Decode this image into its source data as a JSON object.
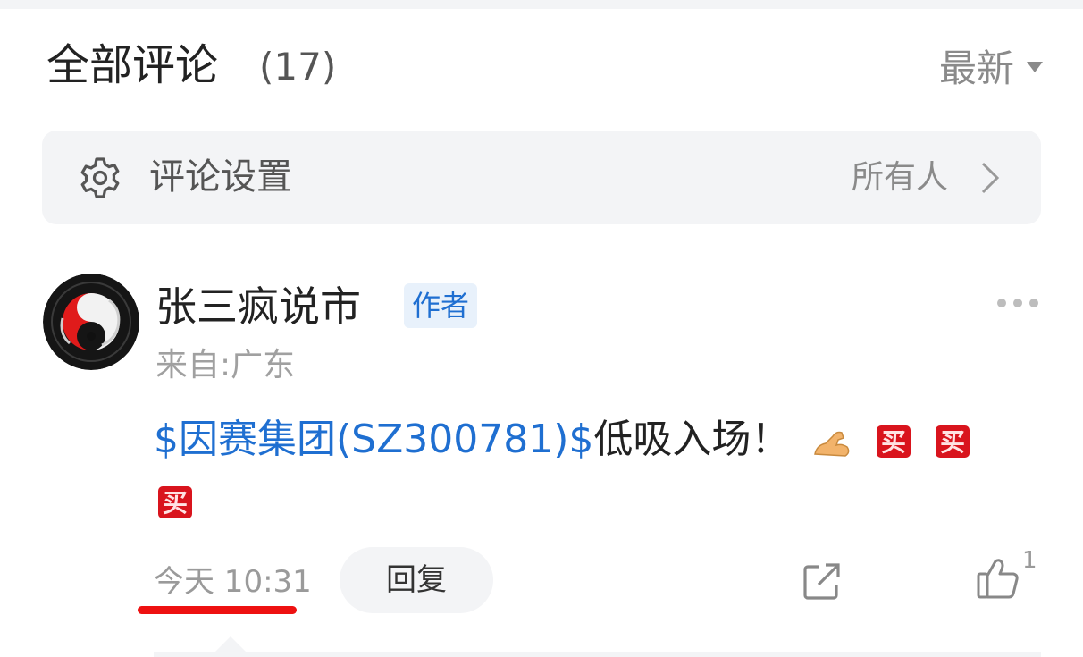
{
  "header": {
    "title": "全部评论",
    "count": "(17)",
    "sort_label": "最新"
  },
  "settings": {
    "label": "评论设置",
    "value": "所有人"
  },
  "comment": {
    "username": "张三疯说市",
    "author_badge": "作者",
    "location": "来自:广东",
    "stock_link": "$因赛集团(SZ300781)$",
    "text": "低吸入场！",
    "emojis": [
      "muscle-emoji",
      "buy-emoji",
      "buy-emoji",
      "buy-emoji"
    ],
    "buy_emoji_char": "买",
    "time": "今天 10:31",
    "reply_label": "回复",
    "like_count": "1"
  },
  "colors": {
    "link_blue": "#1f6fd1",
    "underline_red": "#ee1111",
    "panel_gray": "#f3f4f6"
  }
}
